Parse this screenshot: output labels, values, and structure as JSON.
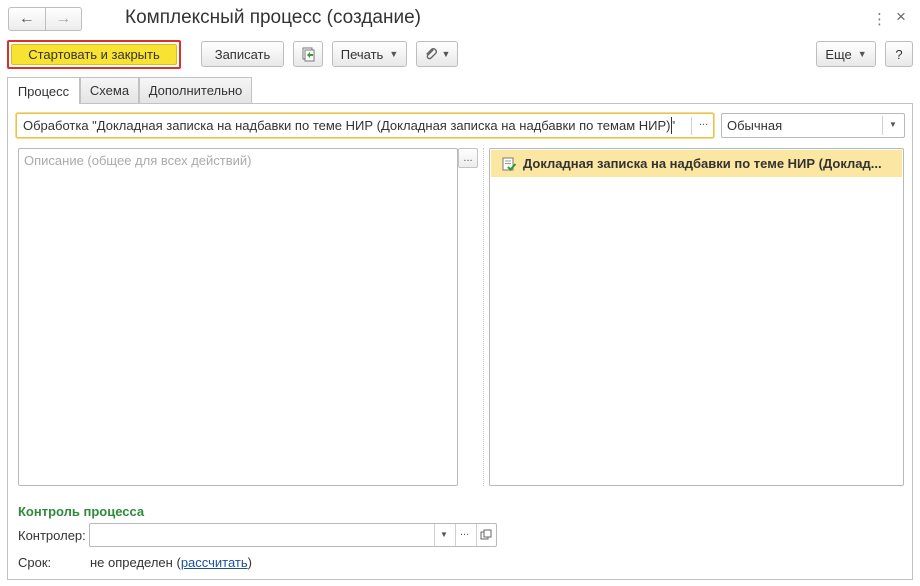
{
  "window": {
    "title": "Комплексный процесс (создание)",
    "back_icon": "arrow-left-icon",
    "forward_icon": "arrow-right-icon"
  },
  "toolbar": {
    "start_close_label": "Стартовать и закрыть",
    "save_label": "Записать",
    "print_label": "Печать",
    "more_label": "Еще",
    "help_label": "?"
  },
  "tabs": [
    {
      "label": "Процесс",
      "active": true
    },
    {
      "label": "Схема",
      "active": false
    },
    {
      "label": "Дополнительно",
      "active": false
    }
  ],
  "process": {
    "name_value": "Обработка \"Докладная записка на надбавки по теме НИР (Докладная записка на надбавки по темам НИР)\"",
    "importance_value": "Обычная",
    "description_placeholder": "Описание (общее для всех действий)",
    "steps": [
      {
        "label": "Докладная записка на надбавки по теме НИР (Доклад..."
      }
    ]
  },
  "control": {
    "section_title": "Контроль процесса",
    "controller_label": "Контролер:",
    "controller_value": "",
    "deadline_label": "Срок:",
    "deadline_value": "не определен",
    "deadline_open_paren": "(",
    "deadline_link": "рассчитать",
    "deadline_close_paren": ")"
  },
  "colors": {
    "accent_button": "#f8e332",
    "highlight_border": "#d93030",
    "section_title": "#2e8b3d",
    "selected_row": "#fbe7a1"
  }
}
